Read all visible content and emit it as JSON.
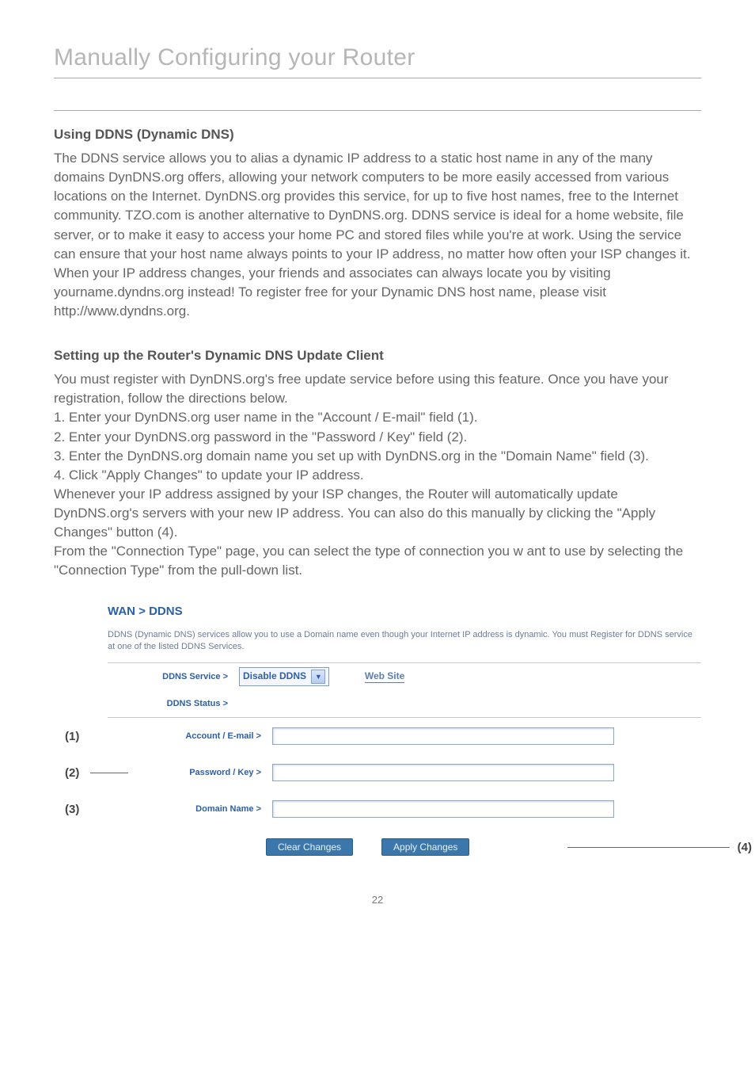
{
  "pageTitle": "Manually Configuring your Router",
  "section1": {
    "heading": "Using DDNS (Dynamic DNS)",
    "body": "The DDNS service allows you to alias a dynamic IP address to a static host name in any of the many domains DynDNS.org offers, allowing your network computers to be more easily accessed from various locations on the Internet. DynDNS.org provides this service, for up to five host names, free to the Internet community. TZO.com is another alternative to DynDNS.org. DDNS service is ideal for a home website, file server, or to make it easy to access your home PC and stored files while you're at work. Using the service can ensure that your host name always points to your IP address, no matter how often your ISP changes it. When your IP address changes, your friends and associates can always locate you by visiting yourname.dyndns.org instead! To register free for your Dynamic DNS host name, please visit http://www.dyndns.org."
  },
  "section2": {
    "heading": "Setting up the Router's Dynamic DNS Update Client",
    "body": "You must register with DynDNS.org's free update service before using this feature. Once you have your registration, follow the directions below.\n1. Enter your DynDNS.org user name in the \"Account / E-mail\" field (1).\n2. Enter your DynDNS.org password in the \"Password / Key\" field (2).\n3. Enter the DynDNS.org domain name you set up with DynDNS.org in the \"Domain Name\" field (3).\n4. Click \"Apply Changes\" to update your IP address.\nWhenever your IP address assigned by your ISP changes, the Router will automatically update DynDNS.org's servers with your new IP address. You can also do this manually by clicking the \"Apply Changes\" button (4).\nFrom the \"Connection Type\" page, you can select the type of connection you w ant to use by selecting the \"Connection Type\" from the pull-down list."
  },
  "ddns": {
    "title": "WAN > DDNS",
    "description": "DDNS (Dynamic DNS) services allow you to use a Domain name even though your Internet IP address is dynamic. You must Register for DDNS service at one of the listed DDNS Services.",
    "serviceLabel": "DDNS Service >",
    "serviceValue": "Disable DDNS",
    "webSite": "Web Site",
    "statusLabel": "DDNS Status >",
    "accountLabel": "Account / E-mail >",
    "passwordLabel": "Password / Key >",
    "domainLabel": "Domain Name >",
    "clearBtn": "Clear Changes",
    "applyBtn": "Apply Changes"
  },
  "callouts": {
    "c1": "(1)",
    "c2": "(2)",
    "c3": "(3)",
    "c4": "(4)"
  },
  "pageNumber": "22"
}
